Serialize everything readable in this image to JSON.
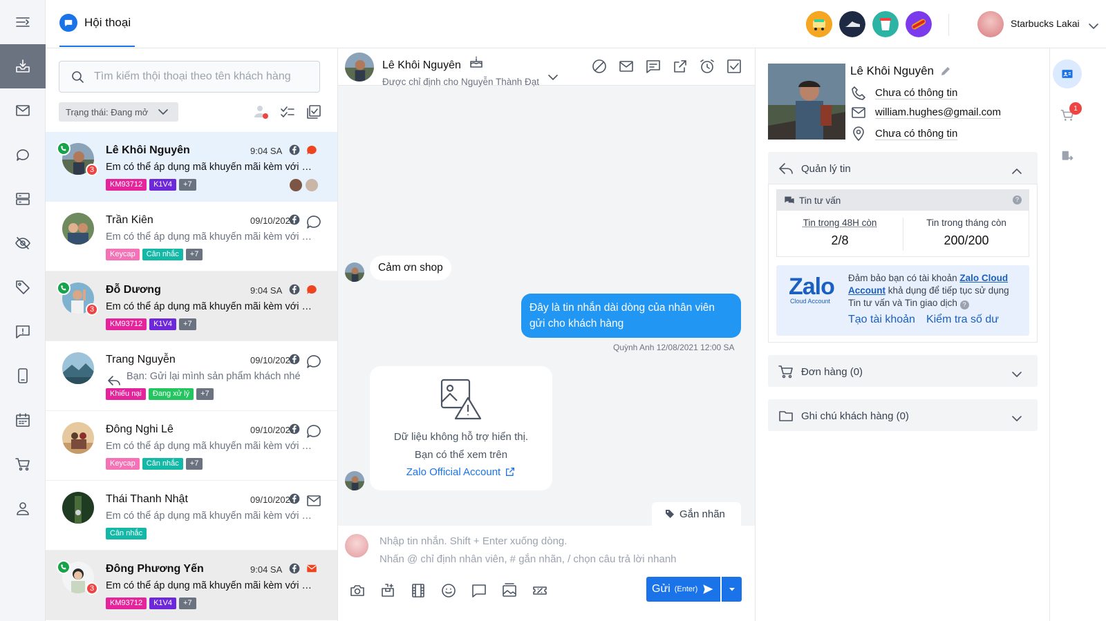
{
  "header": {
    "tab_label": "Hội thoại",
    "user_name": "Starbucks Lakai"
  },
  "search": {
    "placeholder": "Tìm kiếm thội thoại theo tên khách hàng"
  },
  "filter": {
    "status_label": "Trạng thái: Đang mở"
  },
  "conversations": [
    {
      "name": "Lê Khôi Nguyên",
      "time": "9:04 SA",
      "message": "Em có thể áp dụng mã khuyến mãi kèm với sản phẩm",
      "unread": "3",
      "tags": [
        "KM93712",
        "K1V4",
        "+7"
      ]
    },
    {
      "name": "Trần Kiên",
      "time": "09/10/2022",
      "message": "Em có thể áp dụng mã khuyến mãi kèm với sản phẩm",
      "tags": [
        "Keycap",
        "Cân nhắc",
        "+7"
      ]
    },
    {
      "name": "Đỗ Dương",
      "time": "9:04 SA",
      "message": "Em có thể áp dụng mã khuyến mãi kèm với sản phẩm",
      "unread": "3",
      "tags": [
        "KM93712",
        "K1V4",
        "+7"
      ]
    },
    {
      "name": "Trang Nguyễn",
      "time": "09/10/2022",
      "message": "Bạn: Gửi lại mình sản phẩm khách nhé",
      "tags": [
        "Khiếu nại",
        "Đang xử lý",
        "+7"
      ]
    },
    {
      "name": "Đông Nghi Lê",
      "time": "09/10/2022",
      "message": "Em có thể áp dụng mã khuyến mãi kèm với sản phẩm",
      "tags": [
        "Keycap",
        "Cân nhắc",
        "+7"
      ]
    },
    {
      "name": "Thái Thanh Nhật",
      "time": "09/10/2022",
      "message": "Em có thể áp dụng mã khuyến mãi kèm với sản phẩm",
      "tags": [
        "Cân nhắc"
      ]
    },
    {
      "name": "Đông Phương Yến",
      "time": "9:04 SA",
      "message": "Em có thể áp dụng mã khuyến mãi kèm với sản phẩm",
      "unread": "3",
      "tags": [
        "KM93712",
        "K1V4",
        "+7"
      ]
    }
  ],
  "chat": {
    "name": "Lê Khôi Nguyên",
    "assigned": "Được chỉ định cho Nguyễn Thành Đạt",
    "msg_in": "Cảm ơn shop",
    "msg_out": "Đây là tin nhắn dài dòng của nhân viên gửi cho khách hàng",
    "msg_meta": "Quỳnh Anh 12/08/2021 12:00 SA",
    "unsupported_line1": "Dữ liệu không hỗ trợ hiển thị.",
    "unsupported_line2": "Bạn có thể xem trên",
    "unsupported_link": "Zalo Official Account",
    "label_button": "Gắn nhãn",
    "composer_placeholder1": "Nhập tin nhắn. Shift + Enter xuống dòng.",
    "composer_placeholder2": "Nhấn @ chỉ định nhân viên, # gắn nhãn, / chọn câu trả lời nhanh",
    "send_label": "Gửi",
    "send_hint": "(Enter)"
  },
  "customer": {
    "name": "Lê Khôi Nguyên",
    "phone": "Chưa có thông tin",
    "email": "william.hughes@gmail.com",
    "address": "Chưa có thông tin"
  },
  "message_management": {
    "title": "Quản lý tin",
    "consult_title": "Tin tư vấn",
    "quota48_label": "Tin trong 48H còn",
    "quota48_value": "2/8",
    "quota_month_label": "Tin trong tháng còn",
    "quota_month_value": "200/200",
    "zalo_logo": "Zalo",
    "zalo_logo_sub": "Cloud Account",
    "zalo_text_before": "Đảm bảo bạn có tài khoản ",
    "zalo_text_link": "Zalo Cloud Account",
    "zalo_text_after": " khả dụng để tiếp tục sử dụng Tin tư vấn và Tin giao dịch",
    "create_account": "Tạo tài khoản",
    "check_balance": "Kiểm tra số dư"
  },
  "orders": {
    "title": "Đơn hàng (0)"
  },
  "notes": {
    "title": "Ghi chú khách hàng (0)"
  },
  "right_rail": {
    "cart_badge": "1"
  },
  "colors": {
    "primary": "#1a73e8",
    "unread": "#ef4444",
    "online": "#16a34a"
  }
}
